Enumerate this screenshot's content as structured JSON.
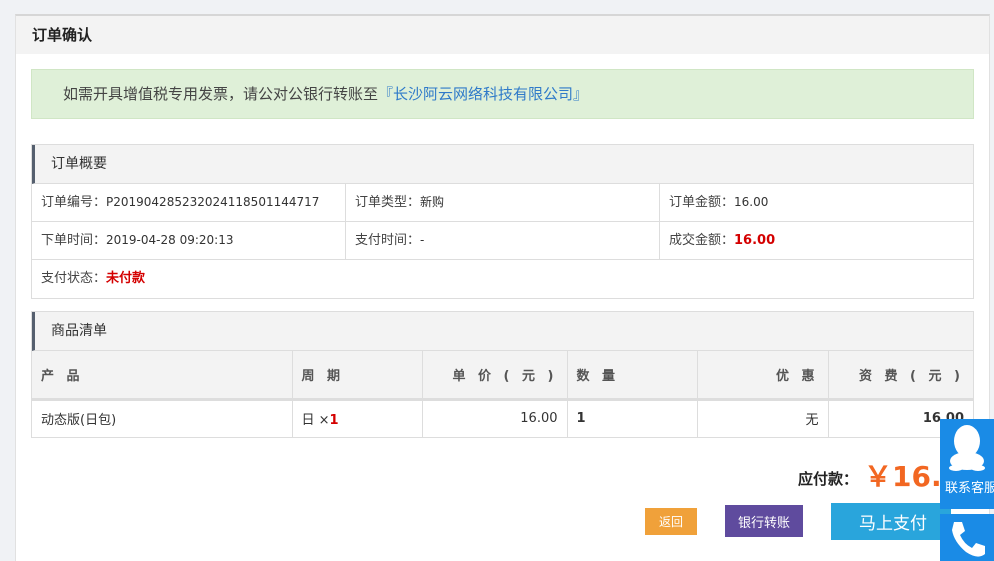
{
  "panel": {
    "title": "订单确认"
  },
  "notice": {
    "text": "如需开具增值税专用发票，请公对公银行转账至",
    "company": "『长沙阿云网络科技有限公司』"
  },
  "summary": {
    "title": "订单概要",
    "order_no_label": "订单编号：",
    "order_no": "P201904285232024118501144717",
    "order_type_label": "订单类型：",
    "order_type": "新购",
    "order_amount_label": "订单金额：",
    "order_amount": "16.00",
    "order_time_label": "下单时间：",
    "order_time": "2019-04-28 09:20:13",
    "pay_time_label": "支付时间：",
    "pay_time": "-",
    "deal_amount_label": "成交金额：",
    "deal_amount": "16.00",
    "pay_status_label": "支付状态：",
    "pay_status": "未付款"
  },
  "goods": {
    "title": "商品清单",
    "headers": {
      "product": "产 品",
      "period": "周 期",
      "price": "单 价 ( 元 )",
      "qty": "数 量",
      "discount": "优 惠",
      "fee": "资 费 ( 元 )"
    },
    "rows": [
      {
        "product": "动态版(日包)",
        "period_unit": "日 ×",
        "period_count": "1",
        "price": "16.00",
        "qty": "1",
        "discount": "无",
        "fee": "16.00"
      }
    ]
  },
  "payment": {
    "label": "应付款：",
    "amount": "￥16.00"
  },
  "buttons": {
    "back": "返回",
    "bank_transfer": "银行转账",
    "pay_now": "马上支付"
  },
  "float": {
    "qq_label": "联系客服"
  },
  "colors": {
    "accent_red": "#d40000",
    "accent_orange": "#f26722",
    "blue": "#29a5dc",
    "purple": "#5f4b9e"
  }
}
